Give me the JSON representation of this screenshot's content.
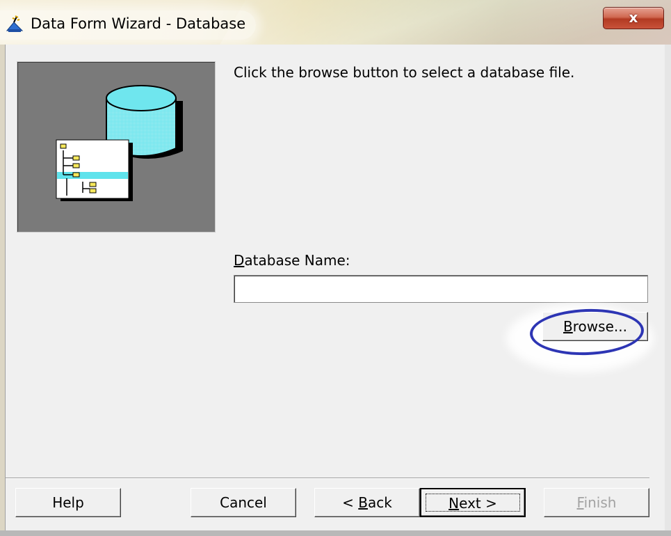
{
  "window": {
    "title": "Data Form Wizard - Database",
    "close_label": "x"
  },
  "instructions": "Click the browse button to select a database file.",
  "database_name": {
    "label_underlined": "D",
    "label_rest": "atabase Name:",
    "value": ""
  },
  "buttons": {
    "browse_underlined": "B",
    "browse_rest": "rowse...",
    "help": "Help",
    "cancel": "Cancel",
    "back_prefix": "< ",
    "back_underlined": "B",
    "back_rest": "ack",
    "next_underlined": "N",
    "next_rest": "ext >",
    "finish_underlined": "F",
    "finish_rest": "inish"
  },
  "state": {
    "finish_enabled": false,
    "default_button": "Next >"
  },
  "colors": {
    "annotation_circle": "#2d35b4",
    "database_cylinder": "#6fe6ee",
    "tree_highlight": "#5fe3ec"
  }
}
